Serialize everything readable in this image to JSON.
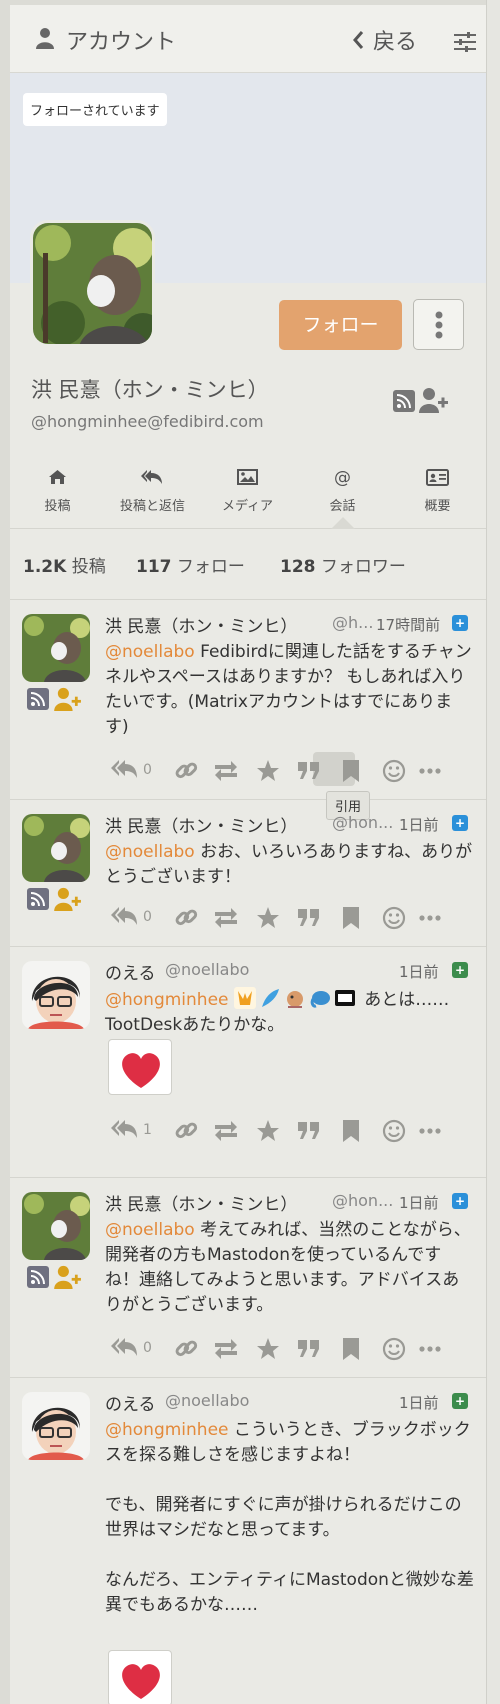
{
  "header": {
    "title": "アカウント",
    "back_label": "戻る"
  },
  "profile": {
    "relationship": "フォローされています",
    "follow_label": "フォロー",
    "display_name": "洪 民憙（ホン・ミンヒ）",
    "account": "@hongminhee@fedibird.com"
  },
  "tabs": [
    {
      "label": "投稿",
      "icon": "home-icon"
    },
    {
      "label": "投稿と返信",
      "icon": "reply-all-icon"
    },
    {
      "label": "メディア",
      "icon": "image-icon"
    },
    {
      "label": "会話",
      "icon": "at-icon"
    },
    {
      "label": "概要",
      "icon": "id-card-icon"
    }
  ],
  "counts": [
    {
      "value": "1.2K",
      "label": "投稿"
    },
    {
      "value": "117",
      "label": "フォロー"
    },
    {
      "value": "128",
      "label": "フォロワー"
    }
  ],
  "tooltip": "引用",
  "statuses": [
    {
      "name": "洪 民憙（ホン・ミンヒ）",
      "acct": "@h...",
      "time": "17時間前",
      "visibility": "+",
      "mention": "@noellabo",
      "text": " Fedibirdに関連した話をするチャンネルやスペースはありますか？ もしあれば入りたいです。(Matrixアカウントはすでにあります)",
      "replies": "0"
    },
    {
      "name": "洪 民憙（ホン・ミンヒ）",
      "acct": "@hon...",
      "time": "1日前",
      "visibility": "+",
      "mention": "@noellabo",
      "text": " おお、いろいろありますね、ありがとうございます！",
      "replies": "0"
    },
    {
      "name": "のえる",
      "acct": "@noellabo",
      "time": "1日前",
      "visibility": "+",
      "mention": "@hongminhee",
      "text_after": " あとは…… TootDeskあたりかな。",
      "replies": "1"
    },
    {
      "name": "洪 民憙（ホン・ミンヒ）",
      "acct": "@hon...",
      "time": "1日前",
      "visibility": "+",
      "mention": "@noellabo",
      "text": " 考えてみれば、当然のことながら、開発者の方もMastodonを使っているんですね！連絡してみようと思います。アドバイスありがとうございます。",
      "replies": "0"
    },
    {
      "name": "のえる",
      "acct": "@noellabo",
      "time": "1日前",
      "visibility": "+",
      "mention": "@hongminhee",
      "text": " こういうとき、ブラックボックスを探る難しさを感じますよね！",
      "text2": "でも、開発者にすぐに声が掛けられるだけこの世界はマシだなと思ってます。",
      "text3": "なんだろ、エンティティにMastodonと微妙な差異でもあるかな……"
    }
  ],
  "colors": {
    "accent": "#e3893a",
    "follow_button": "#e3a36e",
    "visibility_blue": "#2b90d9",
    "visibility_green": "#3c8c4c"
  }
}
